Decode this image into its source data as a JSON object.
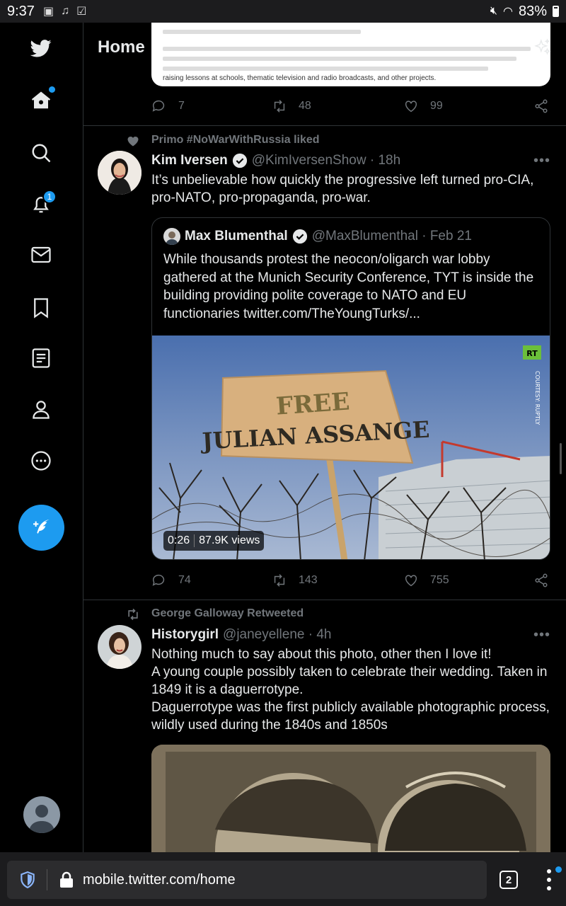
{
  "status_bar": {
    "time": "9:37",
    "battery": "83%"
  },
  "header": {
    "title": "Home"
  },
  "sidebar": {
    "notifications_badge": "1"
  },
  "previous_tweet": {
    "card_line": "raising lessons at schools, thematic television and radio broadcasts, and other projects.",
    "replies": "7",
    "retweets": "48",
    "likes": "99"
  },
  "tweet1": {
    "social_context": "Primo #NoWarWithRussia liked",
    "name": "Kim Iversen",
    "handle_time": "@KimIversenShow · 18h",
    "text": "It’s unbelievable how quickly the progressive left turned pro-CIA, pro-NATO, pro-propaganda, pro-war.",
    "quote": {
      "name": "Max Blumenthal",
      "handle_time": "@MaxBlumenthal · Feb 21",
      "text": "While thousands protest the neocon/oligarch war lobby gathered at the Munich Security Conference, TYT is inside the building providing polite coverage to NATO and EU functionaries twitter.com/TheYoungTurks/...",
      "video_duration": "0:26",
      "video_views": "87.9K views",
      "sign_line1": "FREE",
      "sign_line2": "JULIAN ASSANGE",
      "rt_logo": "RT",
      "courtesy": "COURTESY: RUPTLY"
    },
    "replies": "74",
    "retweets": "143",
    "likes": "755"
  },
  "tweet2": {
    "social_context": "George Galloway Retweeted",
    "name": "Historygirl",
    "handle_time": "@janeyellene · 4h",
    "text_lines": [
      "Nothing much to say about this photo, other then I love it!",
      "A young couple possibly taken to celebrate their wedding. Taken in 1849 it is a daguerrotype.",
      "Daguerrotype was the first publicly available photographic process, wildly used during the 1840s and 1850s"
    ]
  },
  "browser": {
    "url": "mobile.twitter.com/home",
    "tab_count": "2"
  },
  "colors": {
    "accent": "#1d9bf0",
    "background": "#000000",
    "muted": "#71767b"
  }
}
